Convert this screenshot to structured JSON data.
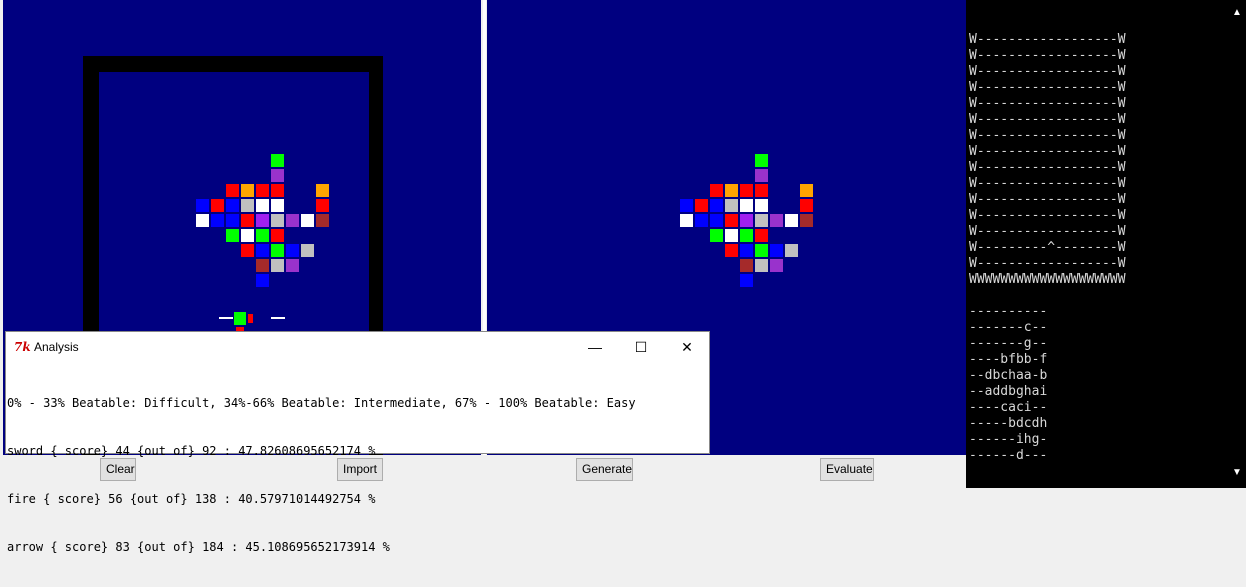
{
  "buttons": {
    "clear": "Clear",
    "import": "Import",
    "generate": "Generate",
    "evaluate": "Evaluate"
  },
  "dialog": {
    "title": "Analysis",
    "icon_text": "7k",
    "minimize": "—",
    "maximize": "☐",
    "close": "✕",
    "lines": [
      "0% - 33% Beatable: Difficult, 34%-66% Beatable: Intermediate, 67% - 100% Beatable: Easy",
      "sword { score} 44 {out of} 92 : 47.82608695652174 %",
      "fire { score} 56 {out of} 138 : 40.57971014492754 %",
      "arrow { score} 83 {out of} 184 : 45.108695652173914 %"
    ]
  },
  "console": {
    "lines": [
      "W------------------W",
      "W------------------W",
      "W------------------W",
      "W------------------W",
      "W------------------W",
      "W------------------W",
      "W------------------W",
      "W------------------W",
      "W------------------W",
      "W------------------W",
      "W------------------W",
      "W------------------W",
      "W------------------W",
      "W---------^--------W",
      "W------------------W",
      "WWWWWWWWWWWWWWWWWWWW",
      "",
      "----------",
      "-------c--",
      "-------g--",
      "----bfbb-f",
      "--dbchaa-b",
      "--addbghai",
      "----caci--",
      "-----bdcdh",
      "------ihg-",
      "------d---"
    ]
  },
  "scroll": {
    "up": "▲",
    "down": "▼"
  },
  "colors": {
    "background": "#000080",
    "a": "#ff0000",
    "b": "#0000ff",
    "c": "#00ff00",
    "d": "#ffffff",
    "e": "#ffa500",
    "f": "#a52a2a",
    "g": "#c0c0c0",
    "h": "#9932cc",
    "i": "#a020f0"
  },
  "sprite": {
    "rows": [
      "-----c----",
      "-----h----",
      "--aeaa--e-",
      "babgdd--a-",
      "dbbaighdf-",
      "--cdca----",
      "---abcbg--",
      "----fgh---",
      "----b-----"
    ]
  }
}
